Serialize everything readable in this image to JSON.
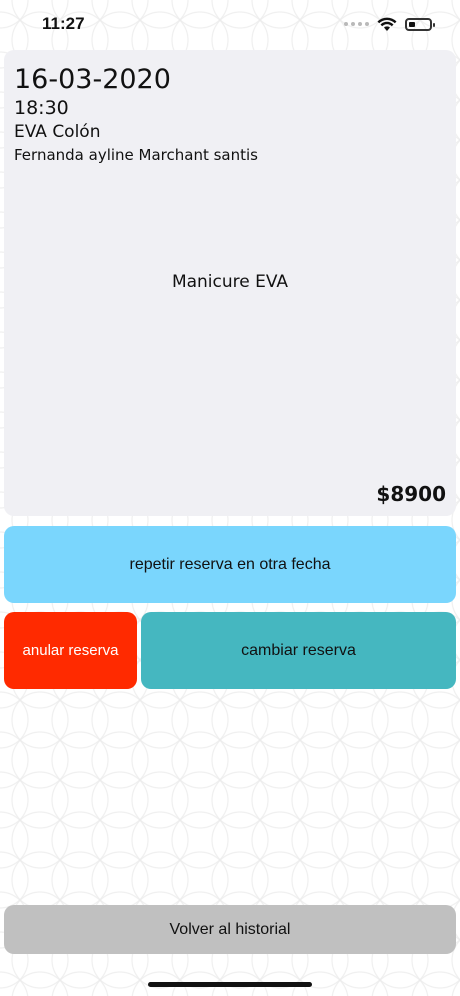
{
  "status_bar": {
    "time": "11:27"
  },
  "reservation": {
    "date": "16-03-2020",
    "time": "18:30",
    "location": "EVA Colón",
    "client": "Fernanda ayline Marchant santis",
    "service": "Manicure EVA",
    "price": "$8900"
  },
  "actions": {
    "repeat_label": "repetir reserva en otra fecha",
    "cancel_label": "anular reserva",
    "change_label": "cambiar reserva",
    "back_label": "Volver al historial"
  },
  "colors": {
    "repeat": "#7ad6fd",
    "cancel": "#ff2a00",
    "change": "#45b7c0",
    "back": "#c0c0c0"
  }
}
